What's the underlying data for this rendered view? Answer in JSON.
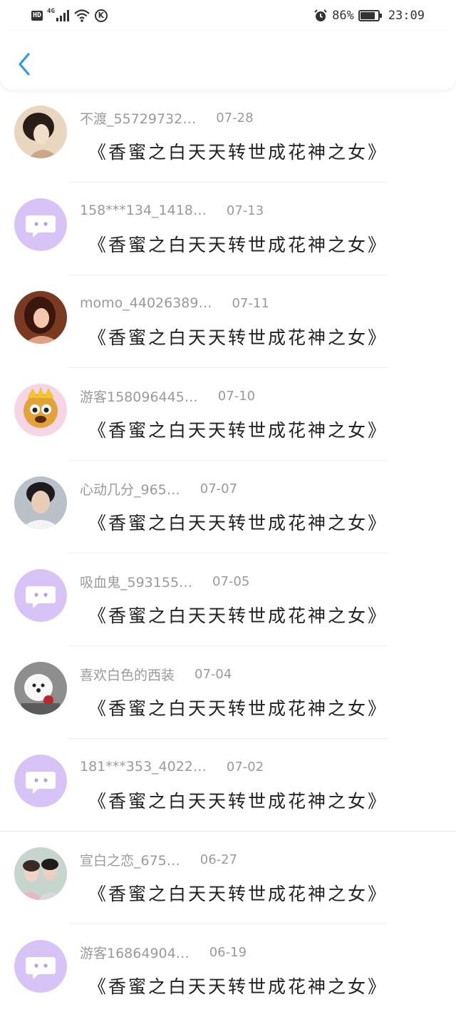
{
  "status_bar": {
    "hd": "HD",
    "network": "4G",
    "battery_percent": "86%",
    "battery_level": 0.86,
    "time": "23:09"
  },
  "header": {
    "back_icon": "chevron-left-icon",
    "accent_color": "#2d9cdb"
  },
  "comments": [
    {
      "username": "不渡_55729732…",
      "date": "07-28",
      "text": "《香蜜之白天天转世成花神之女》",
      "avatar": "photo"
    },
    {
      "username": "158***134_1418…",
      "date": "07-13",
      "text": "《香蜜之白天天转世成花神之女》",
      "avatar": "default"
    },
    {
      "username": "momo_44026389…",
      "date": "07-11",
      "text": "《香蜜之白天天转世成花神之女》",
      "avatar": "photo"
    },
    {
      "username": "游客158096445…",
      "date": "07-10",
      "text": "《香蜜之白天天转世成花神之女》",
      "avatar": "photo"
    },
    {
      "username": "心动几分_965…",
      "date": "07-07",
      "text": "《香蜜之白天天转世成花神之女》",
      "avatar": "photo"
    },
    {
      "username": "吸血鬼_593155…",
      "date": "07-05",
      "text": "《香蜜之白天天转世成花神之女》",
      "avatar": "default"
    },
    {
      "username": "喜欢白色的西装",
      "date": "07-04",
      "text": "《香蜜之白天天转世成花神之女》",
      "avatar": "photo"
    },
    {
      "username": "181***353_4022…",
      "date": "07-02",
      "text": "《香蜜之白天天转世成花神之女》",
      "avatar": "default"
    },
    {
      "username": "宣白之恋_675…",
      "date": "06-27",
      "text": "《香蜜之白天天转世成花神之女》",
      "avatar": "photo"
    },
    {
      "username": "游客16864904…",
      "date": "06-19",
      "text": "《香蜜之白天天转世成花神之女》",
      "avatar": "default"
    }
  ]
}
